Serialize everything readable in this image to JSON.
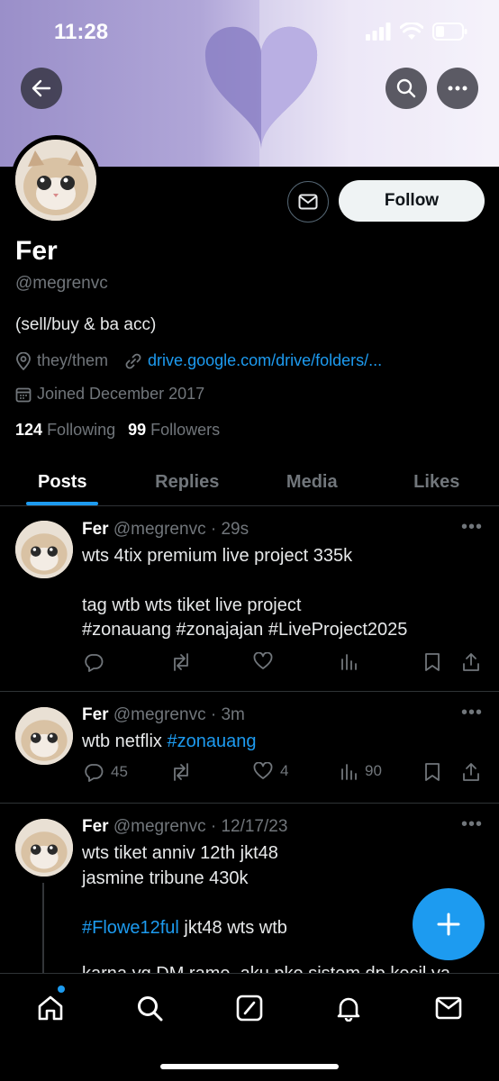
{
  "status_bar": {
    "time": "11:28"
  },
  "profile": {
    "name": "Fer",
    "handle": "@megrenvc",
    "bio": "(sell/buy & ba acc)",
    "pronouns": "they/them",
    "link": "drive.google.com/drive/folders/...",
    "joined": "Joined December 2017",
    "following_count": "124",
    "following_label": "Following",
    "followers_count": "99",
    "followers_label": "Followers",
    "follow_label": "Follow"
  },
  "tabs": [
    {
      "label": "Posts",
      "active": true
    },
    {
      "label": "Replies"
    },
    {
      "label": "Media"
    },
    {
      "label": "Likes"
    }
  ],
  "posts": [
    {
      "name": "Fer",
      "handle_time": "@megrenvc · 29s",
      "line1": "wts 4tix premium live project 335k",
      "line2": "tag wtb wts tiket live project",
      "tags": "#zonauang #zonajajan #LiveProject2025"
    },
    {
      "name": "Fer",
      "handle_time": "@megrenvc · 3m",
      "text": "wtb netflix",
      "tag": "#zonauang",
      "replies": "45",
      "likes": "4",
      "views": "90"
    },
    {
      "name": "Fer",
      "handle_time": "@megrenvc · 12/17/23",
      "line1": "wts tiket anniv 12th jkt48",
      "line2": "jasmine tribune 430k",
      "tag": "#Flowe12ful",
      "tag_rest": " jkt48 wts wtb",
      "peek": "karna yg DM rame, aku pke sistem dp kecil ya"
    }
  ],
  "colors": {
    "accent": "#1d9bf0",
    "background": "#000000",
    "muted": "#71767b"
  }
}
